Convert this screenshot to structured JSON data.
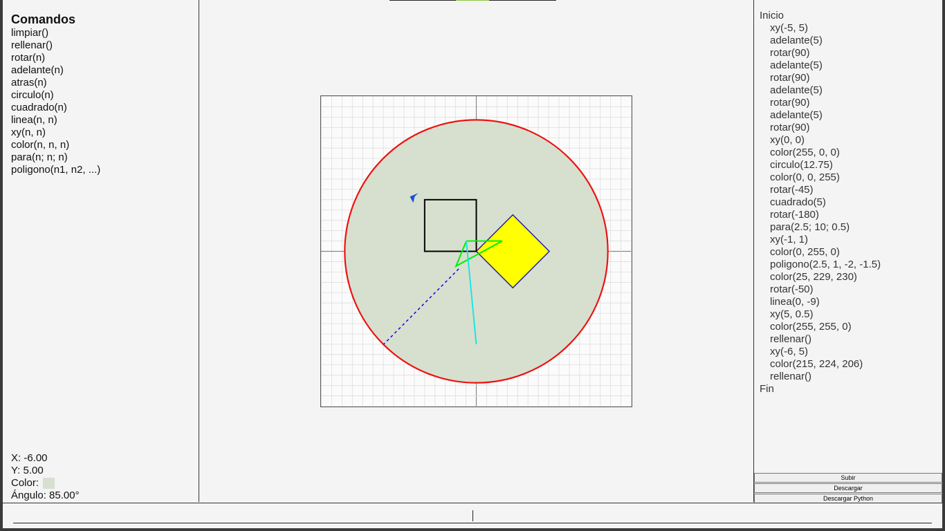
{
  "commands_panel": {
    "title": "Comandos",
    "items": [
      "limpiar()",
      "rellenar()",
      "rotar(n)",
      "adelante(n)",
      "atras(n)",
      "circulo(n)",
      "cuadrado(n)",
      "linea(n, n)",
      "xy(n, n)",
      "color(n, n, n)",
      "para(n; n; n)",
      "poligono(n1, n2, ...)"
    ]
  },
  "status": {
    "x": "X: -6.00",
    "y": "Y: 5.00",
    "color_label": "Color:",
    "color_value": "#d7e0ce",
    "angle": "Ángulo: 85.00°"
  },
  "tabs": {
    "colors": [
      "#222222",
      "#8ec63f",
      "#222222"
    ]
  },
  "program": {
    "lines": [
      {
        "text": "Inicio",
        "indent": false
      },
      {
        "text": "xy(-5, 5)",
        "indent": true
      },
      {
        "text": "adelante(5)",
        "indent": true
      },
      {
        "text": "rotar(90)",
        "indent": true
      },
      {
        "text": "adelante(5)",
        "indent": true
      },
      {
        "text": "rotar(90)",
        "indent": true
      },
      {
        "text": "adelante(5)",
        "indent": true
      },
      {
        "text": "rotar(90)",
        "indent": true
      },
      {
        "text": "adelante(5)",
        "indent": true
      },
      {
        "text": "rotar(90)",
        "indent": true
      },
      {
        "text": "xy(0, 0)",
        "indent": true
      },
      {
        "text": "color(255, 0, 0)",
        "indent": true
      },
      {
        "text": "circulo(12.75)",
        "indent": true
      },
      {
        "text": "color(0, 0, 255)",
        "indent": true
      },
      {
        "text": "rotar(-45)",
        "indent": true
      },
      {
        "text": "cuadrado(5)",
        "indent": true
      },
      {
        "text": "rotar(-180)",
        "indent": true
      },
      {
        "text": "para(2.5; 10; 0.5)",
        "indent": true
      },
      {
        "text": "xy(-1, 1)",
        "indent": true
      },
      {
        "text": "color(0, 255, 0)",
        "indent": true
      },
      {
        "text": "poligono(2.5, 1, -2, -1.5)",
        "indent": true
      },
      {
        "text": "color(25, 229, 230)",
        "indent": true
      },
      {
        "text": "rotar(-50)",
        "indent": true
      },
      {
        "text": "linea(0, -9)",
        "indent": true
      },
      {
        "text": "xy(5, 0.5)",
        "indent": true
      },
      {
        "text": "color(255, 255, 0)",
        "indent": true
      },
      {
        "text": "rellenar()",
        "indent": true
      },
      {
        "text": "xy(-6, 5)",
        "indent": true
      },
      {
        "text": "color(215, 224, 206)",
        "indent": true
      },
      {
        "text": "rellenar()",
        "indent": true
      },
      {
        "text": "Fin",
        "indent": false
      }
    ]
  },
  "buttons": {
    "upload": "Subir",
    "download": "Descargar",
    "download_python": "Descargar Python"
  },
  "console": {
    "value": ""
  },
  "drawing": {
    "colors": {
      "circle_fill": "#d7e0ce",
      "circle_stroke": "#ee1111",
      "square_stroke": "#000000",
      "diamond_fill": "#ffff00",
      "diamond_stroke": "#2222aa",
      "polygon_stroke": "#00ee00",
      "line_stroke": "#19e5e6",
      "path_stroke": "#0000ff",
      "turtle": "#1a4fd8",
      "grid_minor": "#dddddd",
      "grid_axis": "#888888"
    }
  }
}
